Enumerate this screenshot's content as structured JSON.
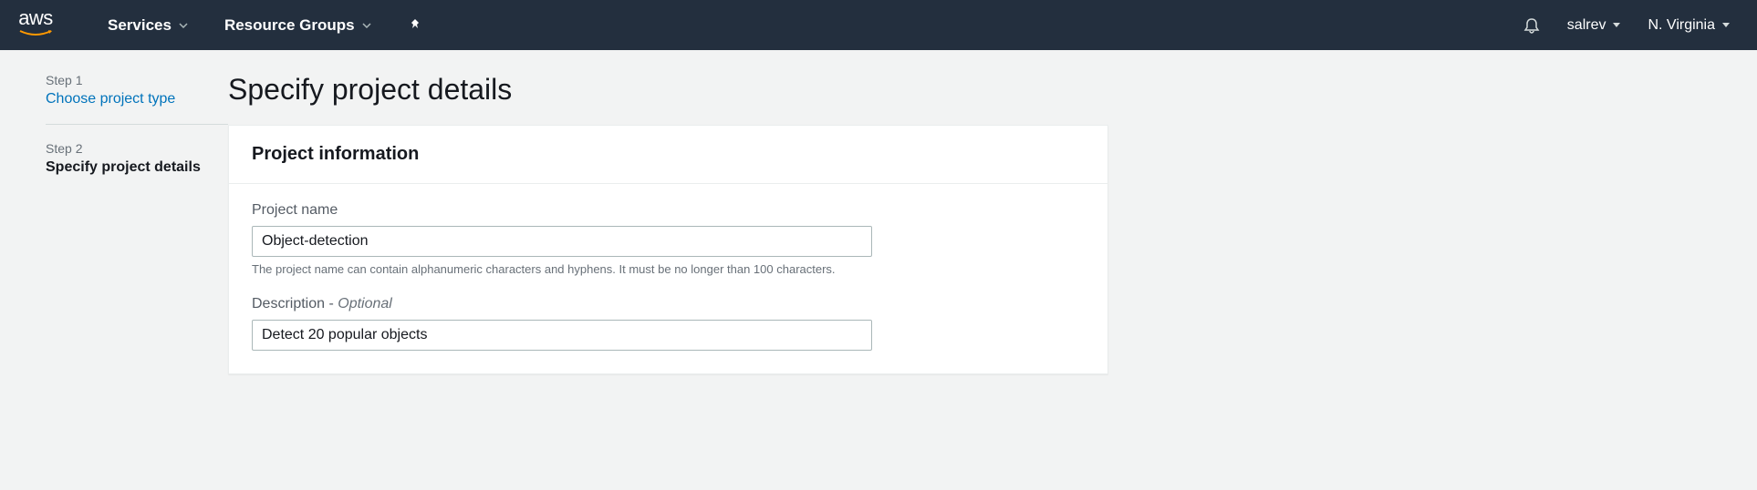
{
  "topnav": {
    "logo_text": "aws",
    "services_label": "Services",
    "resource_groups_label": "Resource Groups",
    "user_label": "salrev",
    "region_label": "N. Virginia"
  },
  "sidebar": {
    "steps": [
      {
        "label": "Step 1",
        "title": "Choose project type"
      },
      {
        "label": "Step 2",
        "title": "Specify project details"
      }
    ]
  },
  "main": {
    "page_title": "Specify project details",
    "panel_title": "Project information",
    "project_name": {
      "label": "Project name",
      "value": "Object-detection",
      "hint": "The project name can contain alphanumeric characters and hyphens. It must be no longer than 100 characters."
    },
    "description": {
      "label": "Description - ",
      "optional_text": "Optional",
      "value": "Detect 20 popular objects"
    }
  }
}
